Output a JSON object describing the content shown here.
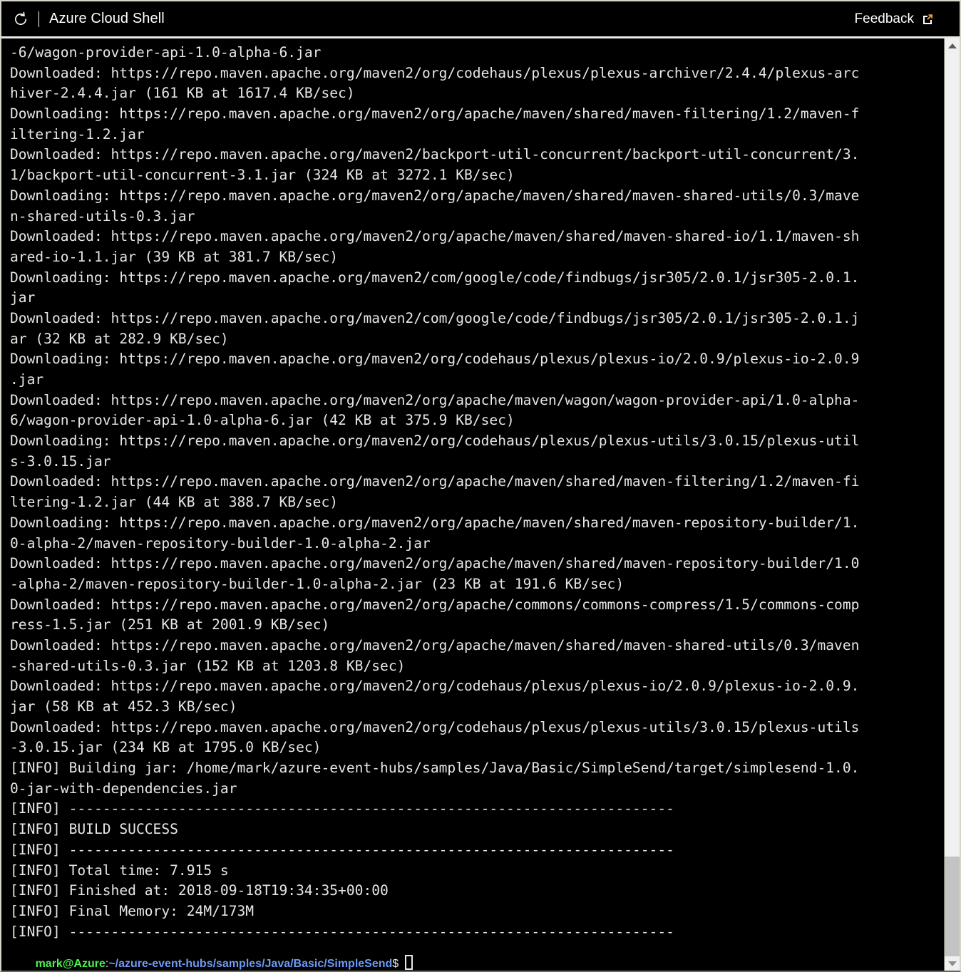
{
  "window": {
    "title": "Azure Cloud Shell"
  },
  "header": {
    "restart_icon": "restart-icon",
    "title": "Azure Cloud Shell",
    "feedback_label": "Feedback",
    "external_link_icon": "external-link-icon",
    "divider": "|"
  },
  "colors": {
    "terminal_bg": "#000000",
    "terminal_fg": "#e6e6e6",
    "prompt_user": "#4ef04e",
    "prompt_path": "#6b9bf7",
    "scrollbar_track": "#f0f0f0",
    "scrollbar_thumb": "#c3c3c3",
    "accent_orange": "#f2a33c",
    "border": "#d8d4cc"
  },
  "terminal": {
    "lines": [
      "-6/wagon-provider-api-1.0-alpha-6.jar",
      "Downloaded: https://repo.maven.apache.org/maven2/org/codehaus/plexus/plexus-archiver/2.4.4/plexus-arc",
      "hiver-2.4.4.jar (161 KB at 1617.4 KB/sec)",
      "Downloading: https://repo.maven.apache.org/maven2/org/apache/maven/shared/maven-filtering/1.2/maven-f",
      "iltering-1.2.jar",
      "Downloaded: https://repo.maven.apache.org/maven2/backport-util-concurrent/backport-util-concurrent/3.",
      "1/backport-util-concurrent-3.1.jar (324 KB at 3272.1 KB/sec)",
      "Downloading: https://repo.maven.apache.org/maven2/org/apache/maven/shared/maven-shared-utils/0.3/mave",
      "n-shared-utils-0.3.jar",
      "Downloaded: https://repo.maven.apache.org/maven2/org/apache/maven/shared/maven-shared-io/1.1/maven-sh",
      "ared-io-1.1.jar (39 KB at 381.7 KB/sec)",
      "Downloading: https://repo.maven.apache.org/maven2/com/google/code/findbugs/jsr305/2.0.1/jsr305-2.0.1.",
      "jar",
      "Downloaded: https://repo.maven.apache.org/maven2/com/google/code/findbugs/jsr305/2.0.1/jsr305-2.0.1.j",
      "ar (32 KB at 282.9 KB/sec)",
      "Downloading: https://repo.maven.apache.org/maven2/org/codehaus/plexus/plexus-io/2.0.9/plexus-io-2.0.9",
      ".jar",
      "Downloaded: https://repo.maven.apache.org/maven2/org/apache/maven/wagon/wagon-provider-api/1.0-alpha-",
      "6/wagon-provider-api-1.0-alpha-6.jar (42 KB at 375.9 KB/sec)",
      "Downloading: https://repo.maven.apache.org/maven2/org/codehaus/plexus/plexus-utils/3.0.15/plexus-util",
      "s-3.0.15.jar",
      "Downloaded: https://repo.maven.apache.org/maven2/org/apache/maven/shared/maven-filtering/1.2/maven-fi",
      "ltering-1.2.jar (44 KB at 388.7 KB/sec)",
      "Downloading: https://repo.maven.apache.org/maven2/org/apache/maven/shared/maven-repository-builder/1.",
      "0-alpha-2/maven-repository-builder-1.0-alpha-2.jar",
      "Downloaded: https://repo.maven.apache.org/maven2/org/apache/maven/shared/maven-repository-builder/1.0",
      "-alpha-2/maven-repository-builder-1.0-alpha-2.jar (23 KB at 191.6 KB/sec)",
      "Downloaded: https://repo.maven.apache.org/maven2/org/apache/commons/commons-compress/1.5/commons-comp",
      "ress-1.5.jar (251 KB at 2001.9 KB/sec)",
      "Downloaded: https://repo.maven.apache.org/maven2/org/apache/maven/shared/maven-shared-utils/0.3/maven",
      "-shared-utils-0.3.jar (152 KB at 1203.8 KB/sec)",
      "Downloaded: https://repo.maven.apache.org/maven2/org/codehaus/plexus/plexus-io/2.0.9/plexus-io-2.0.9.",
      "jar (58 KB at 452.3 KB/sec)",
      "Downloaded: https://repo.maven.apache.org/maven2/org/codehaus/plexus/plexus-utils/3.0.15/plexus-utils",
      "-3.0.15.jar (234 KB at 1795.0 KB/sec)",
      "[INFO] Building jar: /home/mark/azure-event-hubs/samples/Java/Basic/SimpleSend/target/simplesend-1.0.",
      "0-jar-with-dependencies.jar",
      "[INFO] ------------------------------------------------------------------------",
      "[INFO] BUILD SUCCESS",
      "[INFO] ------------------------------------------------------------------------",
      "[INFO] Total time: 7.915 s",
      "[INFO] Finished at: 2018-09-18T19:34:35+00:00",
      "[INFO] Final Memory: 24M/173M",
      "[INFO] ------------------------------------------------------------------------"
    ],
    "prompt": {
      "user_host": "mark@Azure",
      "separator": ":",
      "path": "~/azure-event-hubs/samples/Java/Basic/SimpleSend",
      "symbol": "$",
      "input": ""
    }
  },
  "scrollbar": {
    "up_arrow_icon": "scroll-up-arrow-icon",
    "down_arrow_icon": "scroll-down-arrow-icon",
    "thumb_position": "bottom"
  }
}
